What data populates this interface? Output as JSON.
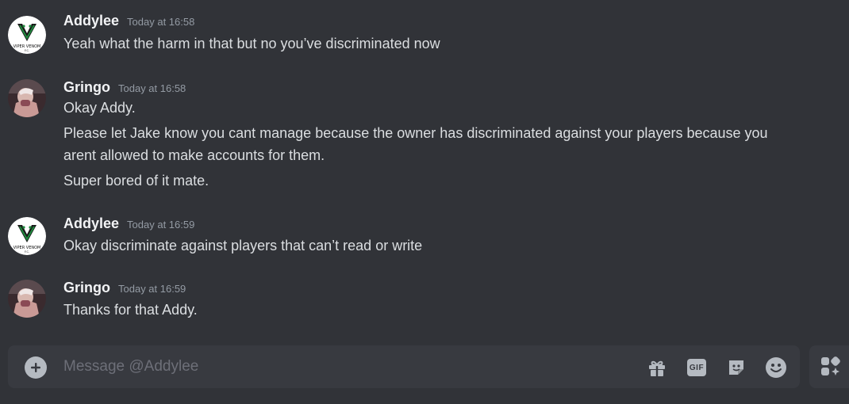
{
  "messages": [
    {
      "username": "Addylee",
      "timestamp": "Today at 16:58",
      "avatar": "viper-venom-logo-avatar",
      "lines": [
        "Yeah what the harm in that but no you’ve discriminated now"
      ]
    },
    {
      "username": "Gringo",
      "timestamp": "Today at 16:58",
      "avatar": "user-photo-avatar",
      "lines": [
        "Okay Addy.",
        "Please let Jake know you cant manage because the owner has discriminated against your players because you",
        "arent allowed to make accounts for them.",
        "Super bored of it mate."
      ]
    },
    {
      "username": "Addylee",
      "timestamp": "Today at 16:59",
      "avatar": "viper-venom-logo-avatar",
      "lines": [
        "Okay discriminate against players that can’t read or write"
      ]
    },
    {
      "username": "Gringo",
      "timestamp": "Today at 16:59",
      "avatar": "user-photo-avatar",
      "lines": [
        "Thanks for that Addy."
      ]
    }
  ],
  "composer": {
    "placeholder": "Message @Addylee",
    "gif_label": "GIF",
    "icons": [
      "add-icon",
      "gift-icon",
      "gif-icon",
      "sticker-icon",
      "emoji-icon",
      "apps-icon"
    ]
  },
  "logo_text": {
    "top": "VIPER VENOM",
    "bottom": "F.C."
  },
  "colors": {
    "background": "#313338",
    "composer": "#383a40",
    "username": "#f2f3f5",
    "text": "#dbdee1",
    "timestamp": "#949ba4",
    "icon": "#b5bac1",
    "logo_green": "#1f8a3e"
  }
}
